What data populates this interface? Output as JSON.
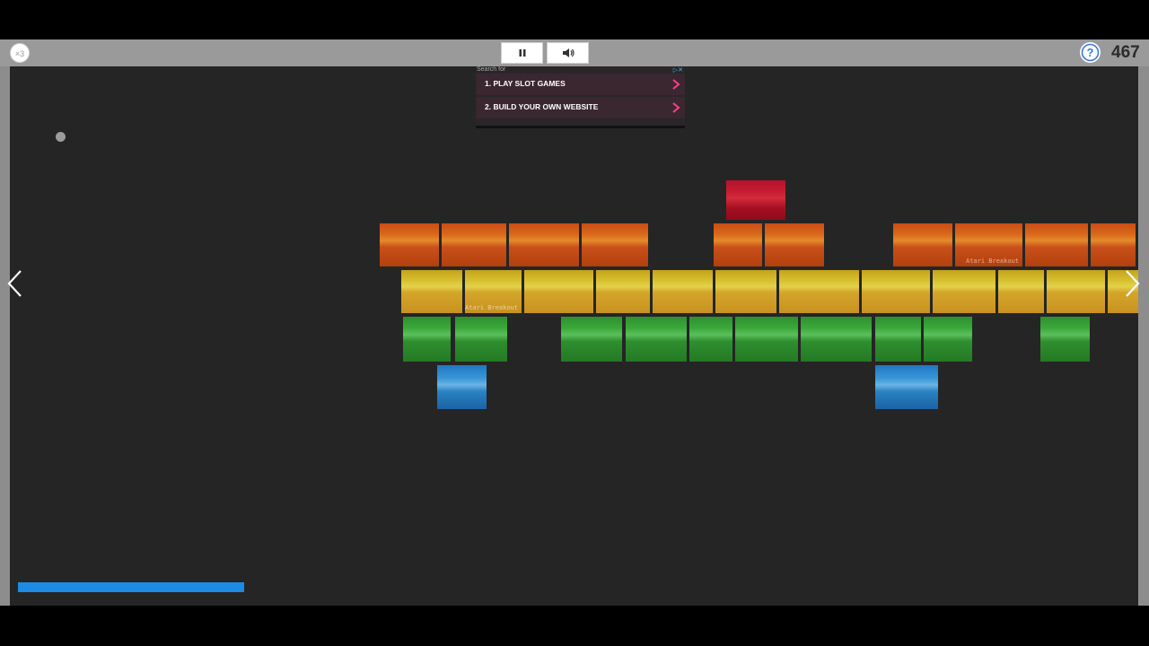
{
  "hud": {
    "lives": "×3",
    "score": "467"
  },
  "controls": {
    "pause_icon": "pause-icon",
    "sound_icon": "speaker-icon",
    "help_icon": "question-icon"
  },
  "ad": {
    "search_label": "Search for",
    "choices_icon": "ad-choices-icon",
    "items": [
      {
        "label": "1. PLAY SLOT GAMES"
      },
      {
        "label": "2. BUILD YOUR OWN WEBSITE"
      }
    ]
  },
  "bricks": {
    "watermark": "Atari Breakout"
  },
  "colors": {
    "background": "#252525",
    "paddle": "#1d8be3",
    "ball": "#9c9c9c",
    "bar": "#9a9a9a",
    "ad_arrow": "#ff3e8a"
  }
}
